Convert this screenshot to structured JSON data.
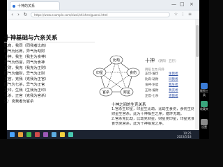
{
  "browser": {
    "tab_title": "十神的关系",
    "url": "https://www.example.com/ziwei/shishen/guanxi.html",
    "nav": {
      "back": "‹",
      "forward": "›",
      "refresh": "↻"
    },
    "window": {
      "min": "—",
      "max": "□",
      "close": "×"
    }
  },
  "document": {
    "title": "十神基础与六亲关系",
    "lines": [
      "比肩，我同（同我者比肩）",
      "同气为比肩，异气为劫财",
      "食神，我生（我生为食神）",
      "异气为伤官，同气为食神",
      "正财，我克（我克为正财）",
      "同气为偏财，异气为正财",
      "正官，克我（克我为正官）",
      "同气为七杀，异气为正官",
      "正印，生我（生我为正印）",
      "七杀，正官（克我为官杀）",
      "注：克我者为官杀"
    ],
    "diagram": {
      "nodes": [
        "比劫",
        "食伤",
        "财星",
        "官杀",
        "印星"
      ]
    }
  },
  "right_panel": {
    "title": "十神",
    "subtitle": "（阴阳 · 五行）",
    "header": "阴阳   生克   同异",
    "rows": [
      {
        "a": "正印·偏印",
        "b": "生我者"
      },
      {
        "a": "比肩·劫财",
        "b": "同我者"
      },
      {
        "a": "食神·伤官",
        "b": "我生者"
      },
      {
        "a": "正财·偏财",
        "b": "我克者"
      },
      {
        "a": "正官·七杀",
        "b": "克我者"
      }
    ]
  },
  "bottom": {
    "title": "十神之间的生克关系",
    "lines": [
      "1.官杀生印星，印星生比劫，比劫生食伤，食伤生财星，",
      "财星生官杀。此为十神相生之序，循环无端。",
      "2.官杀克比劫，比劫克财星，财星克印星，印星克食伤，",
      "食伤克官杀，此为十神相克之序。"
    ]
  },
  "taskbar": {
    "time": "10:25",
    "date": "2023/5/18"
  },
  "side_panel": {
    "buttons": [
      "截图工具",
      "收藏夹",
      "设置"
    ]
  }
}
